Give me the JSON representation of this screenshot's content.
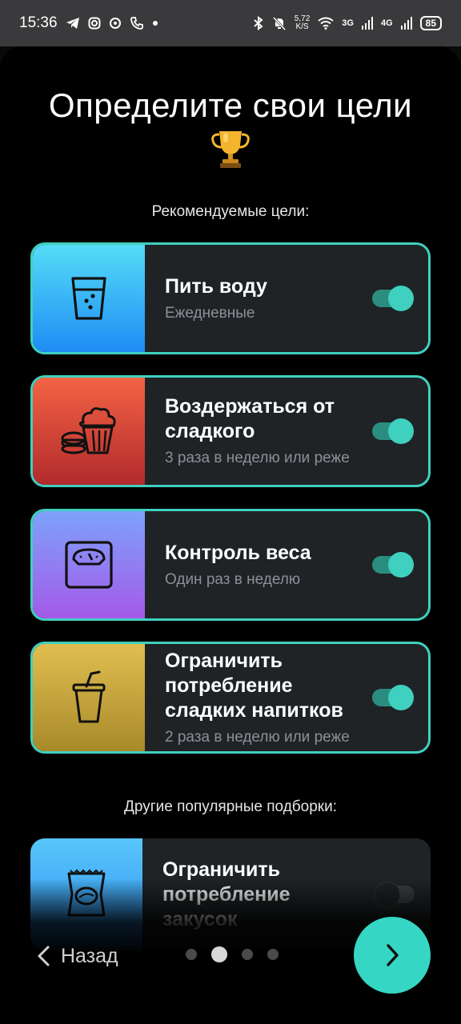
{
  "status_bar": {
    "time": "15:36",
    "speed_value": "5,72",
    "speed_unit": "K/S",
    "net1": "3G",
    "net2": "4G",
    "battery": "85"
  },
  "header": {
    "title": "Определите свои цели"
  },
  "recommended": {
    "label": "Рекомендуемые цели:",
    "items": [
      {
        "name": "Пить воду",
        "frequency": "Ежедневные",
        "icon": "water-glass-icon",
        "enabled": true
      },
      {
        "name": "Воздержаться от сладкого",
        "frequency": "3 раза в неделю или реже",
        "icon": "cake-icon",
        "enabled": true
      },
      {
        "name": "Контроль веса",
        "frequency": "Один раз в неделю",
        "icon": "scale-icon",
        "enabled": true
      },
      {
        "name": "Ограничить потребление сладких напитков",
        "frequency": "2 раза в неделю или реже",
        "icon": "soda-cup-icon",
        "enabled": true
      }
    ]
  },
  "other": {
    "label": "Другие популярные подборки:",
    "items": [
      {
        "name": "Ограничить потребление закусок",
        "frequency": "",
        "icon": "chips-bag-icon",
        "enabled": false
      }
    ]
  },
  "nav": {
    "back_label": "Назад",
    "pages": 4,
    "current_page": 2
  },
  "colors": {
    "accent": "#3fd0bf",
    "card_bg": "#1f2326",
    "background": "#000000"
  }
}
